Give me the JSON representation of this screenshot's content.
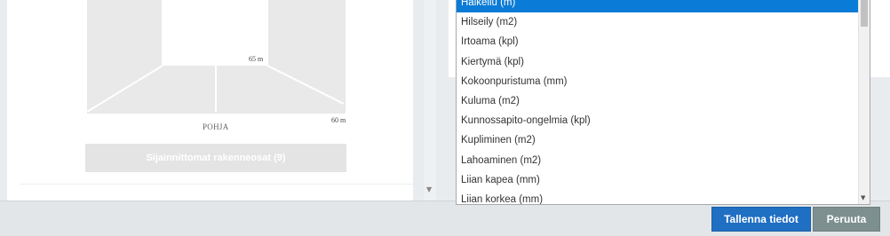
{
  "floor_plan": {
    "floor_label": "POHJA",
    "dim_inner": "65 m",
    "dim_outer": "60 m"
  },
  "unplaced_button_label": "Sijainnittomat rakenneosat (9)",
  "dropdown": {
    "options": [
      "Halkeilu (m)",
      "Hilseily (m2)",
      "Irtoama (kpl)",
      "Kiertymä (kpl)",
      "Kokoonpuristuma (mm)",
      "Kuluma (m2)",
      "Kunnossapito-ongelmia (kpl)",
      "Kupliminen (m2)",
      "Lahoaminen (m2)",
      "Liian kapea (mm)",
      "Liian korkea (mm)"
    ],
    "selected_index": 0
  },
  "footer": {
    "save_label": "Tallenna tiedot",
    "cancel_label": "Peruuta"
  },
  "colors": {
    "selected_option": "#0a7bd6",
    "save_button": "#1f6fc3",
    "cancel_button": "#7d8f8f"
  }
}
